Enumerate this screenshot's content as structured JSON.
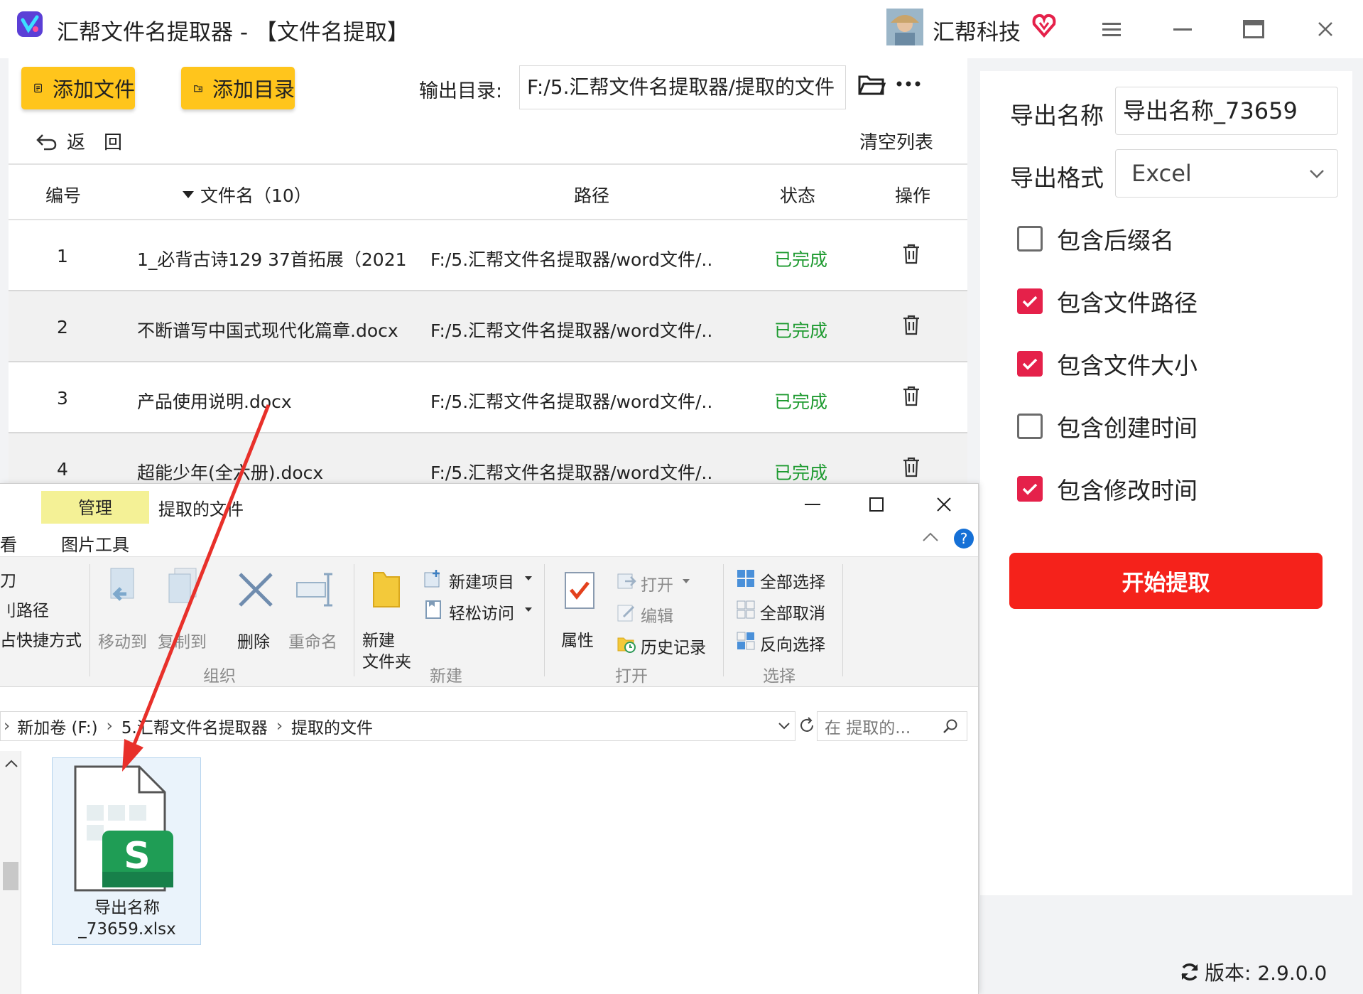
{
  "app": {
    "title": "汇帮文件名提取器 - 【文件名提取】",
    "brand": "汇帮科技"
  },
  "toolbar": {
    "add_file": "添加文件",
    "add_dir": "添加目录",
    "output_label": "输出目录:",
    "output_path": "F:/5.汇帮文件名提取器/提取的文件",
    "back": "返　回",
    "clear_list": "清空列表"
  },
  "table": {
    "headers": {
      "no": "编号",
      "name": "文件名（10）",
      "path": "路径",
      "status": "状态",
      "action": "操作"
    },
    "rows": [
      {
        "no": "1",
        "name": "1_必背古诗129 37首拓展（2021...",
        "path": "F:/5.汇帮文件名提取器/word文件/...",
        "status": "已完成"
      },
      {
        "no": "2",
        "name": "不断谱写中国式现代化篇章.docx",
        "path": "F:/5.汇帮文件名提取器/word文件/...",
        "status": "已完成"
      },
      {
        "no": "3",
        "name": "产品使用说明.docx",
        "path": "F:/5.汇帮文件名提取器/word文件/...",
        "status": "已完成"
      },
      {
        "no": "4",
        "name": "超能少年(全六册).docx",
        "path": "F:/5.汇帮文件名提取器/word文件/...",
        "status": "已完成"
      }
    ]
  },
  "settings": {
    "export_name_label": "导出名称",
    "export_name_value": "导出名称_73659",
    "export_format_label": "导出格式",
    "export_format_value": "Excel",
    "options": [
      {
        "label": "包含后缀名",
        "checked": false
      },
      {
        "label": "包含文件路径",
        "checked": true
      },
      {
        "label": "包含文件大小",
        "checked": true
      },
      {
        "label": "包含创建时间",
        "checked": false
      },
      {
        "label": "包含修改时间",
        "checked": true
      }
    ],
    "start_button": "开始提取",
    "version": "版本: 2.9.0.0"
  },
  "explorer": {
    "manage_tab": "管理",
    "title": "提取的文件",
    "tab_view_partial": "看",
    "tab_picture_tools": "图片工具",
    "partial_items": [
      "刀",
      "刂路径",
      "占快捷方式"
    ],
    "organize": {
      "move_to": "移动到",
      "copy_to": "复制到",
      "delete": "删除",
      "rename": "重命名",
      "group": "组织"
    },
    "new": {
      "new_folder_line1": "新建",
      "new_folder_line2": "文件夹",
      "new_item": "新建项目",
      "easy_access": "轻松访问",
      "group": "新建"
    },
    "open": {
      "properties": "属性",
      "open": "打开",
      "edit": "编辑",
      "history": "历史记录",
      "group": "打开"
    },
    "select": {
      "select_all": "全部选择",
      "select_none": "全部取消",
      "invert": "反向选择",
      "group": "选择"
    },
    "breadcrumb": [
      "新加卷 (F:)",
      "5.汇帮文件名提取器",
      "提取的文件"
    ],
    "search_placeholder": "在 提取的...",
    "file_name_line1": "导出名称",
    "file_name_line2": "_73659.xlsx",
    "file_icon_letter": "S"
  },
  "colors": {
    "accent_yellow": "#ffc51c",
    "start_red": "#f5221b",
    "checkbox_red": "#e5214a",
    "status_green": "#1d9a2f",
    "arrow_red": "#e8302a"
  }
}
